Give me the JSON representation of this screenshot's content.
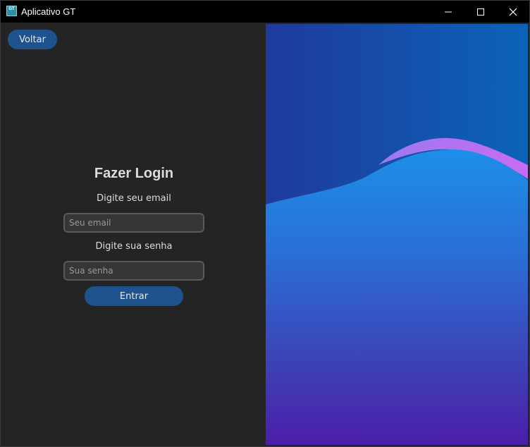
{
  "window": {
    "title": "Aplicativo GT",
    "icon_label": "GT",
    "icon": "app-icon",
    "controls": [
      "minimize-icon",
      "maximize-icon",
      "close-icon"
    ]
  },
  "toolbar": {
    "back_label": "Voltar"
  },
  "login": {
    "title": "Fazer Login",
    "email_label": "Digite seu email",
    "email_placeholder": "Seu email",
    "email_value": "",
    "password_label": "Digite sua senha",
    "password_placeholder": "Sua senha",
    "password_value": "",
    "submit_label": "Entrar"
  },
  "colors": {
    "background": "#242424",
    "button": "#1f538d",
    "input_bg": "#343638",
    "input_border": "#565b5e",
    "text": "#dcdcdc",
    "illustration_top": "#1b3fa0",
    "illustration_wave": "#1e8ee6",
    "illustration_bottom": "#4a1faa",
    "illustration_accent": "#c06ef0"
  }
}
